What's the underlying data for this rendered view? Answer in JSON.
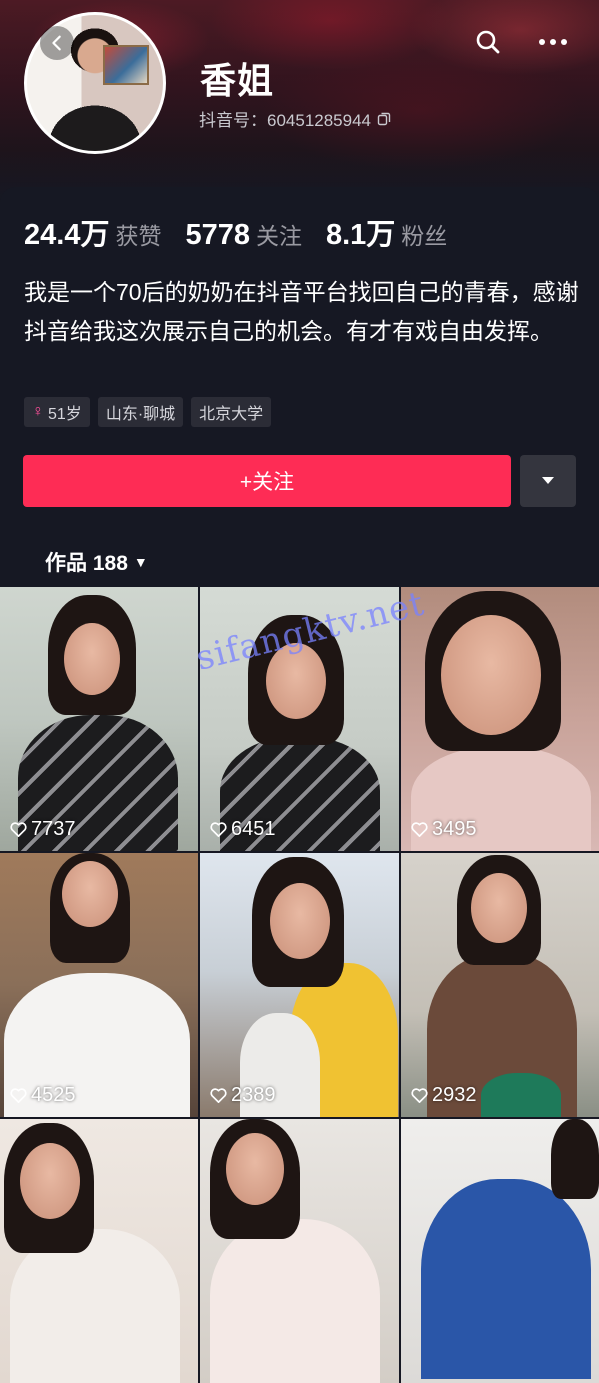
{
  "profile": {
    "name": "香姐",
    "douyin_id": "抖音号：60451285944",
    "stats": [
      {
        "value": "24.4万",
        "label": "获赞"
      },
      {
        "value": "5778",
        "label": "关注"
      },
      {
        "value": "8.1万",
        "label": "粉丝"
      }
    ],
    "bio": "我是一个70后的奶奶在抖音平台找回自己的青春，感谢抖音给我这次展示自己的机会。有才有戏自由发挥。",
    "tags": [
      {
        "icon": "female-icon",
        "text": "51岁"
      },
      {
        "text": "山东·聊城"
      },
      {
        "text": "北京大学"
      }
    ],
    "follow_label": "+关注",
    "works_label": "作品 188"
  },
  "videos": [
    {
      "likes": "7737"
    },
    {
      "likes": "6451"
    },
    {
      "likes": "3495"
    },
    {
      "likes": "4525"
    },
    {
      "likes": "2389"
    },
    {
      "likes": "2932"
    },
    {
      "likes": ""
    },
    {
      "likes": ""
    },
    {
      "likes": ""
    }
  ],
  "watermark": "sifangktv.net",
  "colors": {
    "background": "#161823",
    "follow_button": "#fe2c55",
    "tag_background": "#2b2c36",
    "female_icon": "#ff4f9b"
  }
}
